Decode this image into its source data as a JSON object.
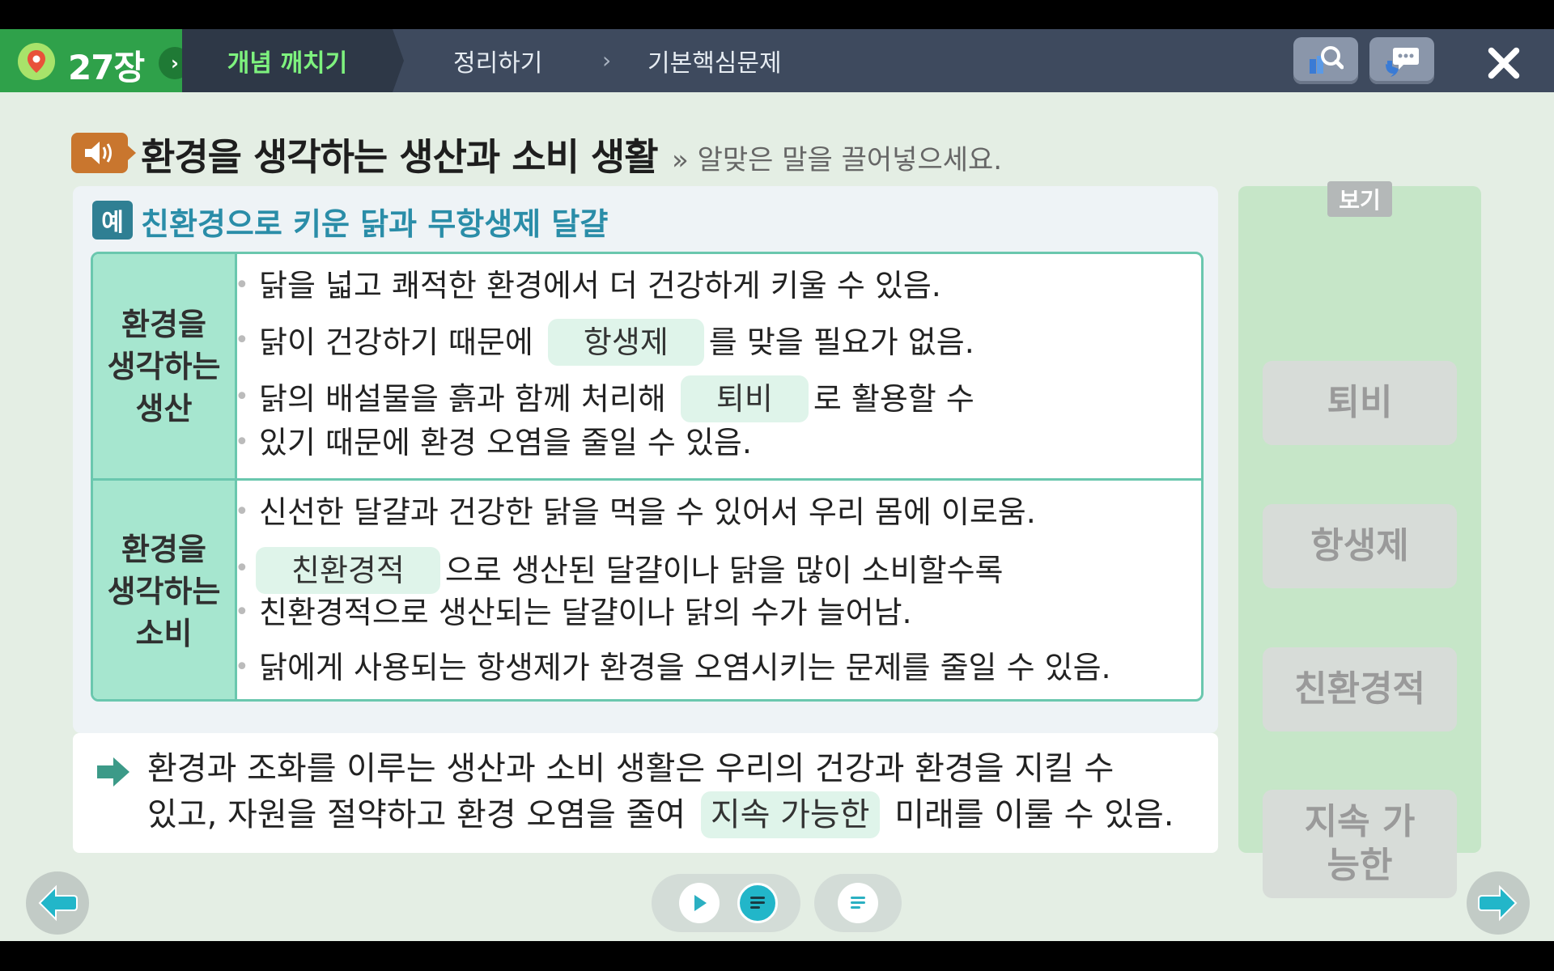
{
  "navbar": {
    "chapter_label": "27장",
    "tabs": [
      {
        "label": "개념 깨치기",
        "active": true
      },
      {
        "label": "정리하기",
        "active": false
      },
      {
        "label": "기본핵심문제",
        "active": false
      }
    ],
    "separator": "›"
  },
  "heading": {
    "title": "환경을 생각하는 생산과 소비 생활",
    "instruction": "» 알맞은 말을 끌어넣으세요."
  },
  "example": {
    "badge": "예",
    "title": "친환경으로 키운 닭과 무항생제 달걀",
    "rows": [
      {
        "header_lines": [
          "환경을",
          "생각하는",
          "생산"
        ],
        "bullets": [
          {
            "before": "닭을 넓고 쾌적한 환경에서 더 건강하게 키울 수 있음.",
            "blank": "",
            "after": ""
          },
          {
            "before": "닭이 건강하기 때문에",
            "blank": "항생제",
            "after": "를 맞을 필요가 없음."
          },
          {
            "before": "닭의 배설물을 흙과 함께 처리해",
            "blank": "퇴비",
            "after": "로 활용할 수",
            "continuation": "있기 때문에 환경 오염을 줄일 수 있음."
          }
        ]
      },
      {
        "header_lines": [
          "환경을",
          "생각하는",
          "소비"
        ],
        "bullets": [
          {
            "before": "신선한 달걀과 건강한 닭을 먹을 수 있어서 우리 몸에 이로움.",
            "blank": "",
            "after": ""
          },
          {
            "before": "",
            "blank": "친환경적",
            "after": "으로 생산된 달걀이나 닭을 많이 소비할수록",
            "continuation": "친환경적으로 생산되는 달걀이나 닭의 수가 늘어남."
          },
          {
            "before": "닭에게 사용되는 항생제가 환경을 오염시키는 문제를 줄일 수 있음.",
            "blank": "",
            "after": ""
          }
        ]
      }
    ]
  },
  "summary": {
    "line1": "환경과 조화를 이루는 생산과 소비 생활은 우리의 건강과 환경을 지킬 수",
    "line2_before": "있고, 자원을 절약하고 환경 오염을 줄여",
    "line2_blank": "지속 가능한",
    "line2_after": "미래를 이룰 수 있음."
  },
  "choices": {
    "label": "보기",
    "items": [
      "퇴비",
      "항생제",
      "친환경적",
      "지속 가능한"
    ]
  },
  "colors": {
    "nav_bg": "#3e4a5e",
    "chapter_green": "#2fa14a",
    "active_tab_text": "#7ef27e",
    "table_border": "#6ac7ae",
    "row_header_bg": "#a6e6cf",
    "blank_bg": "#dff4ea",
    "side_panel_bg": "#c6e6c8",
    "accent_teal": "#2a8da8"
  },
  "icons": {
    "chapter": "map-pin-icon",
    "search": "search-book-icon",
    "chat": "chat-bubble-icon",
    "close": "close-icon",
    "speaker": "speaker-icon",
    "prev": "arrow-left-icon",
    "next": "arrow-right-icon",
    "play": "play-icon",
    "script": "script-icon"
  }
}
